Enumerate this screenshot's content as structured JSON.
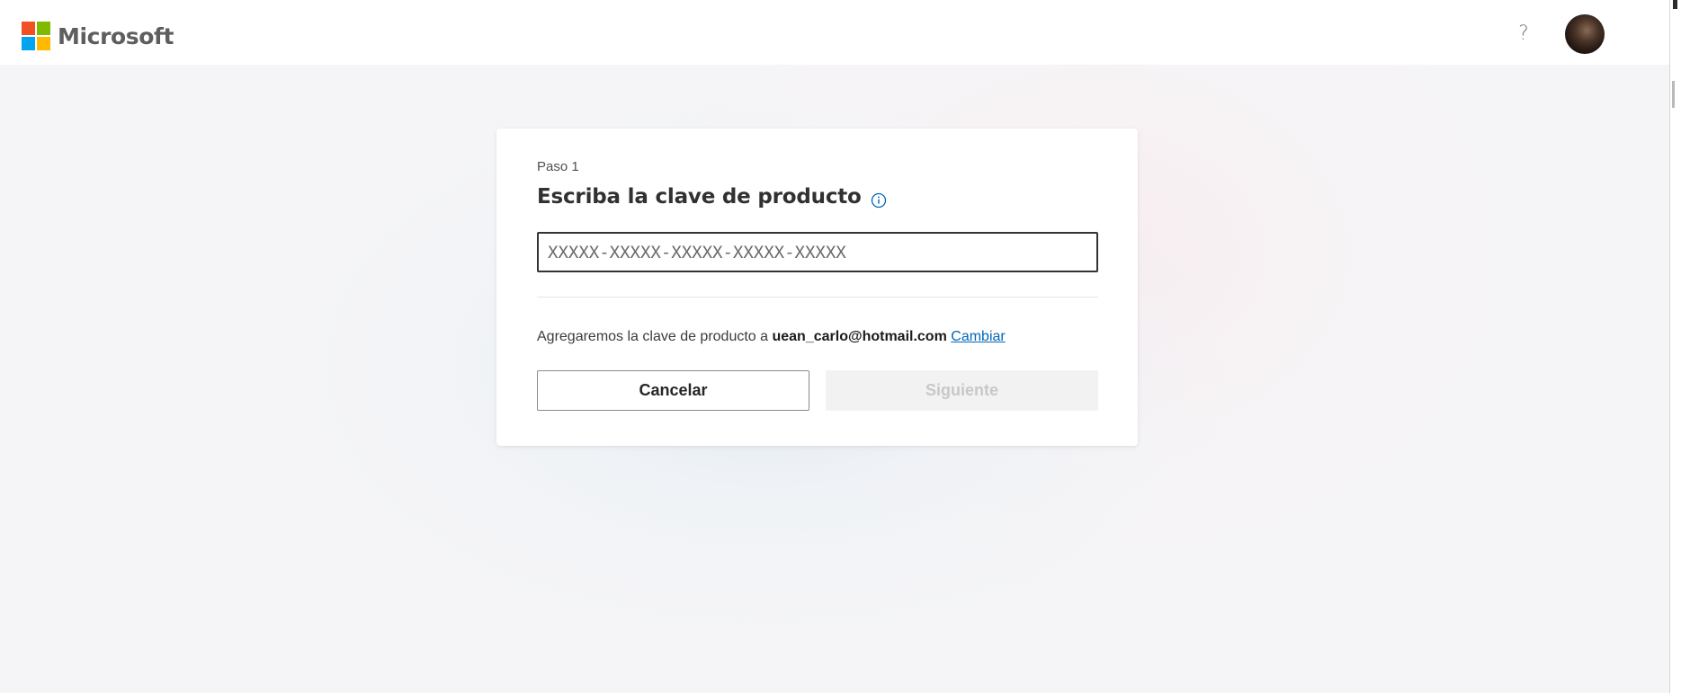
{
  "header": {
    "brand": "Microsoft",
    "brand_colors": [
      "#f25022",
      "#7fba00",
      "#00a4ef",
      "#ffb900"
    ],
    "help_label": "?",
    "avatar_icon": "user-avatar"
  },
  "card": {
    "step_label": "Paso 1",
    "title": "Escriba la clave de producto",
    "info_icon": "info-icon",
    "product_key_input": {
      "value": "",
      "placeholder": "XXXXX-XXXXX-XXXXX-XXXXX-XXXXX"
    },
    "account_text_prefix": "Agregaremos la clave de producto a ",
    "account_email": "uean_carlo@hotmail.com",
    "change_link": "Cambiar",
    "cancel_label": "Cancelar",
    "next_label": "Siguiente"
  },
  "colors": {
    "accent_link": "#0067b8",
    "disabled_button_bg": "#f2f2f2",
    "disabled_button_text": "#c8c8c8"
  }
}
